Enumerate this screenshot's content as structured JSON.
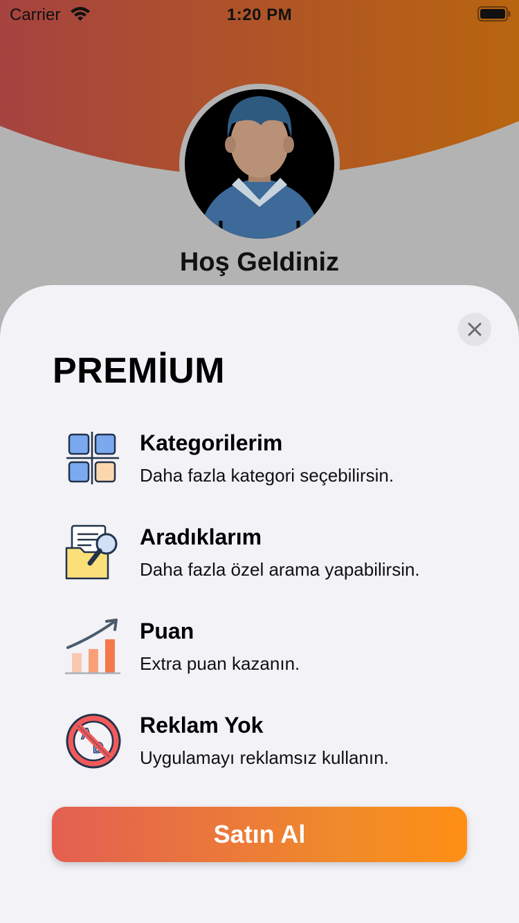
{
  "status_bar": {
    "carrier": "Carrier",
    "time": "1:20 PM"
  },
  "header": {
    "welcome": "Hoş Geldiniz",
    "gradient_start": "#a64340",
    "gradient_end": "#b8650f"
  },
  "sheet": {
    "title": "PREMİUM",
    "close_icon": "close-icon",
    "features": [
      {
        "icon": "categories-grid-icon",
        "title": "Kategorilerim",
        "description": "Daha fazla kategori seçebilirsin."
      },
      {
        "icon": "folder-search-icon",
        "title": "Aradıklarım",
        "description": "Daha fazla özel arama yapabilirsin."
      },
      {
        "icon": "growth-chart-icon",
        "title": "Puan",
        "description": "Extra puan kazanın."
      },
      {
        "icon": "no-ads-icon",
        "title": "Reklam Yok",
        "description": "Uygulamayı reklamsız kullanın."
      }
    ],
    "buy_button": "Satın Al"
  },
  "colors": {
    "sheet_background": "#f2f2f7",
    "backdrop": "#b3b3b3",
    "button_gradient_start": "#e35f52",
    "button_gradient_end": "#ff8f14"
  }
}
